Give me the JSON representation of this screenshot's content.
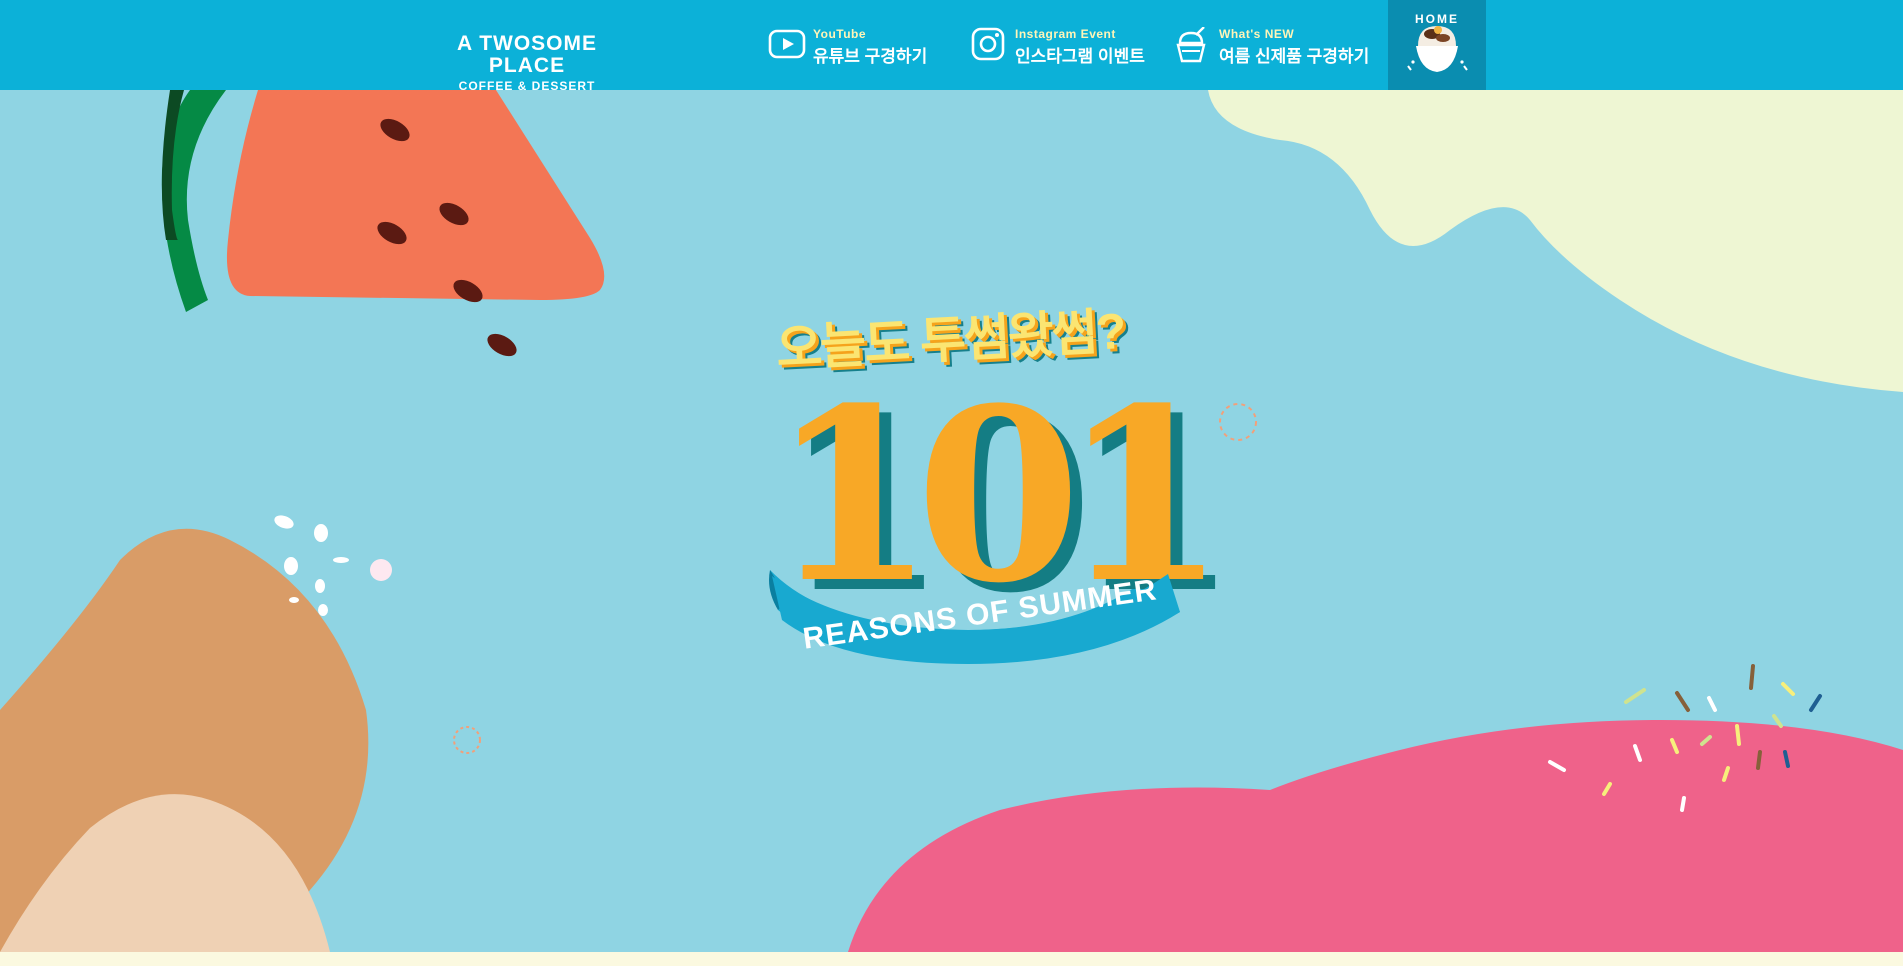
{
  "header": {
    "brand": {
      "name": "A TWOSOME PLACE",
      "sub": "COFFEE & DESSERT"
    },
    "nav": [
      {
        "icon": "youtube-icon",
        "sub": "YouTube",
        "label": "유튜브 구경하기"
      },
      {
        "icon": "instagram-icon",
        "sub": "Instagram Event",
        "label": "인스타그램 이벤트"
      },
      {
        "icon": "bingsu-icon",
        "sub": "What's NEW",
        "label": "여름 신제품 구경하기"
      }
    ],
    "home": {
      "label": "HOME",
      "icon": "bingsu-dessert-icon"
    }
  },
  "hero": {
    "tagline": "오늘도 투썸왔썸?",
    "number": "101",
    "ribbon": "REASONS OF SUMMER"
  },
  "colors": {
    "header_bg": "#0cb1d8",
    "home_bg": "#0a8db0",
    "hero_bg": "#8fd4e3",
    "watermelon": "#f37655",
    "cream": "#eef6d3",
    "caramel": "#d99c67",
    "pink": "#ef628a",
    "ribbon": "#18a9d0",
    "number_orange": "#f8a826"
  }
}
